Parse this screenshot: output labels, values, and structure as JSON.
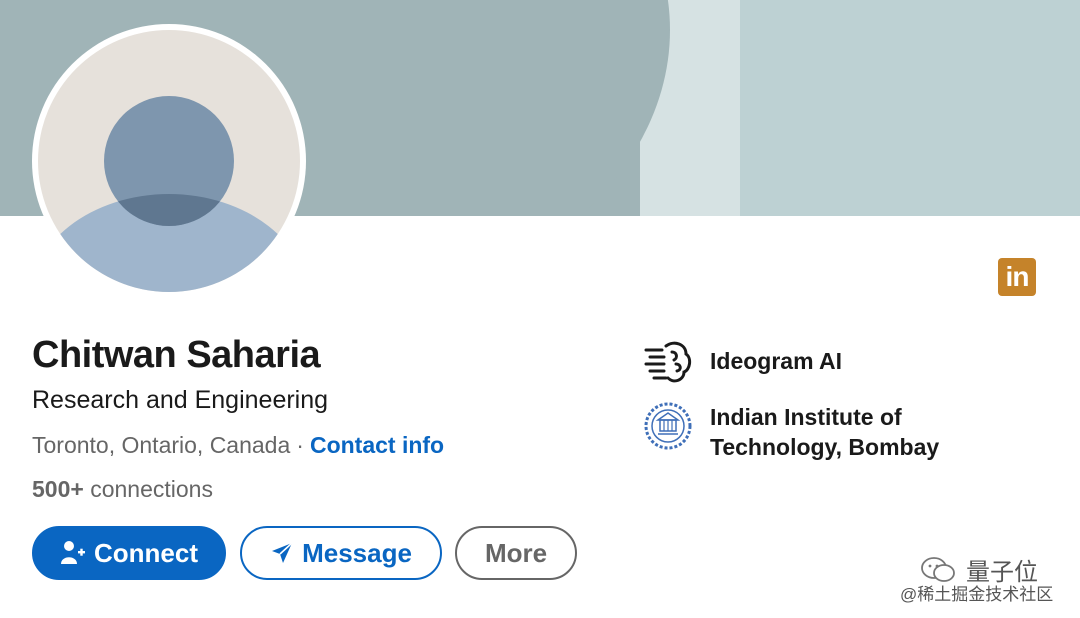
{
  "profile": {
    "name": "Chitwan Saharia",
    "headline": "Research and Engineering",
    "location": "Toronto, Ontario, Canada",
    "separator": "·",
    "contact_label": "Contact info",
    "connections_count": "500+",
    "connections_label": "connections"
  },
  "badge": {
    "icon": "linkedin-icon",
    "text": "in",
    "color": "#c5832a"
  },
  "actions": {
    "connect_label": "Connect",
    "connect_icon": "add-person-icon",
    "message_label": "Message",
    "message_icon": "send-icon",
    "more_label": "More"
  },
  "organizations": [
    {
      "name": "Ideogram AI",
      "logo": "brain-lines-icon"
    },
    {
      "name": "Indian Institute of Technology, Bombay",
      "logo": "iit-bombay-seal-icon"
    }
  ],
  "watermark": {
    "line1": "量子位",
    "line2": "@稀土掘金技术社区",
    "icon": "wechat-icon"
  },
  "colors": {
    "accent": "#0a66c2",
    "banner": "#a0b4b7",
    "text": "#1a1a1a",
    "muted": "#666666"
  }
}
